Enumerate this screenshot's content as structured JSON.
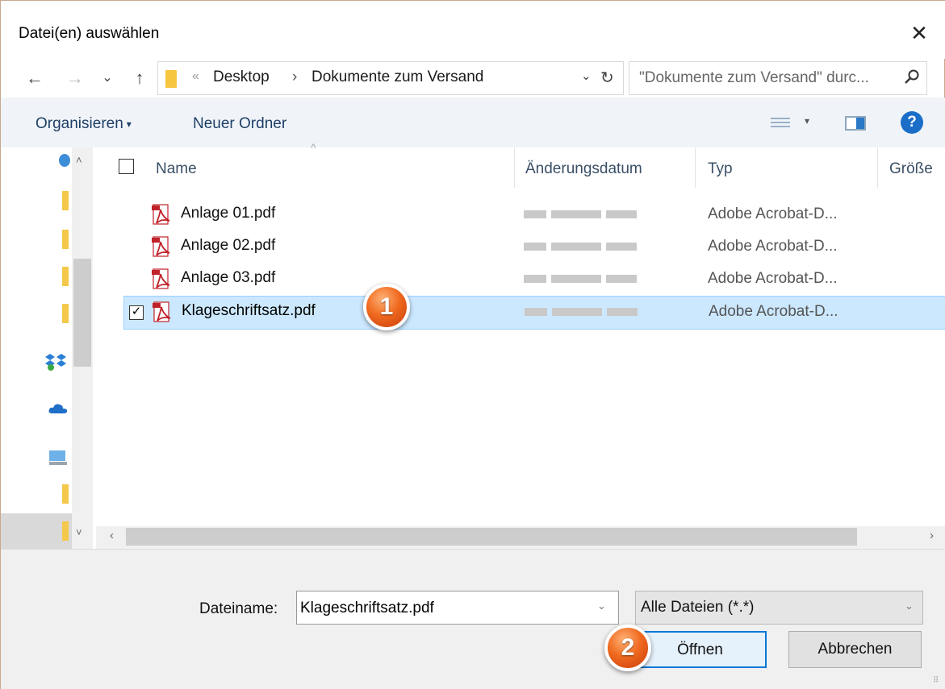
{
  "window": {
    "title": "Datei(en) auswählen",
    "close_glyph": "✕"
  },
  "address_bar": {
    "back": "←",
    "forward": "→",
    "recent": "⌄",
    "up": "↑",
    "crumb_sep0": "«",
    "crumbs": [
      "Desktop",
      "Dokumente zum Versand"
    ],
    "crumb_arrow": "›",
    "dropdown": "⌄",
    "refresh": "↻"
  },
  "search": {
    "placeholder": "\"Dokumente zum Versand\" durc...",
    "icon": "search-icon"
  },
  "toolbar": {
    "organize_label": "Organisieren",
    "organize_caret": "▾",
    "new_folder_label": "Neuer Ordner",
    "view_caret": "▾",
    "help_glyph": "?"
  },
  "columns": {
    "name": "Name",
    "date": "Änderungsdatum",
    "type": "Typ",
    "size": "Größe",
    "sort_indicator": "^"
  },
  "files": [
    {
      "name": "Anlage 01.pdf",
      "type": "Adobe Acrobat-D...",
      "selected": false
    },
    {
      "name": "Anlage 02.pdf",
      "type": "Adobe Acrobat-D...",
      "selected": false
    },
    {
      "name": "Anlage 03.pdf",
      "type": "Adobe Acrobat-D...",
      "selected": false
    },
    {
      "name": "Klageschriftsatz.pdf",
      "type": "Adobe Acrobat-D...",
      "selected": true
    }
  ],
  "row_check_glyph": "✓",
  "badges": [
    "1",
    "2"
  ],
  "scroll": {
    "left": "‹",
    "right": "›",
    "up": "˄",
    "down": "˅"
  },
  "footer": {
    "filename_label": "Dateiname:",
    "filename_value": "Klageschriftsatz.pdf",
    "filename_dd": "⌄",
    "filetype_value": "Alle Dateien (*.*)",
    "filetype_dd": "⌄",
    "open_label": "Öffnen",
    "cancel_label": "Abbrechen",
    "grip": "⠿"
  },
  "colors": {
    "accent": "#0078d7",
    "selection": "#cce8ff",
    "folder": "#f4c84a",
    "pdf_red": "#c0222a",
    "badge": "#f06a1f"
  }
}
